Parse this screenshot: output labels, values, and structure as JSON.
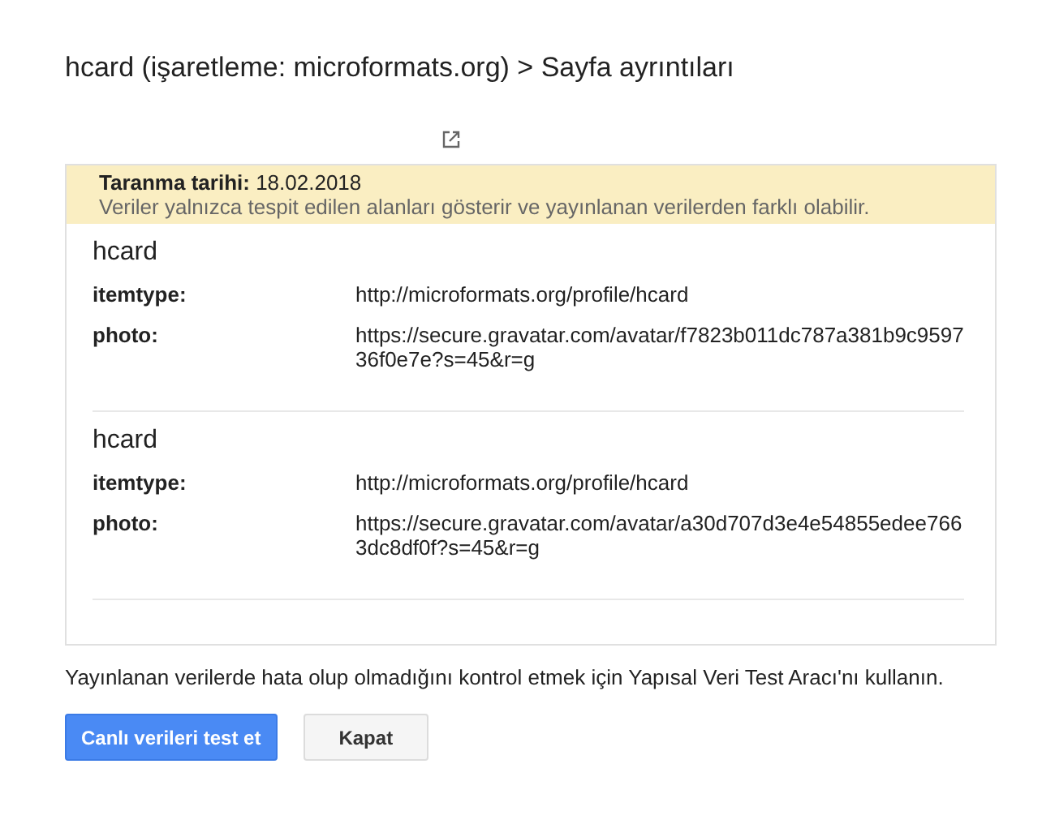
{
  "title": "hcard (işaretleme: microformats.org) > Sayfa ayrıntıları",
  "notice": {
    "label": "Taranma tarihi:",
    "date": "18.02.2018",
    "message": "Veriler yalnızca tespit edilen alanları gösterir ve yayınlanan verilerden farklı olabilir."
  },
  "items": [
    {
      "name": "hcard",
      "properties": [
        {
          "key": "itemtype:",
          "value": "http://microformats.org/profile/hcard"
        },
        {
          "key": "photo:",
          "value": "https://secure.gravatar.com/avatar/f7823b011dc787a381b9c959736f0e7e?s=45&r=g"
        }
      ]
    },
    {
      "name": "hcard",
      "properties": [
        {
          "key": "itemtype:",
          "value": "http://microformats.org/profile/hcard"
        },
        {
          "key": "photo:",
          "value": "https://secure.gravatar.com/avatar/a30d707d3e4e54855edee7663dc8df0f?s=45&r=g"
        }
      ]
    }
  ],
  "footer_text": "Yayınlanan verilerde hata olup olmadığını kontrol etmek için Yapısal Veri Test Aracı'nı kullanın.",
  "buttons": [
    {
      "label": "Canlı verileri test et",
      "kind": "primary"
    },
    {
      "label": "Kapat",
      "kind": "secondary"
    }
  ]
}
